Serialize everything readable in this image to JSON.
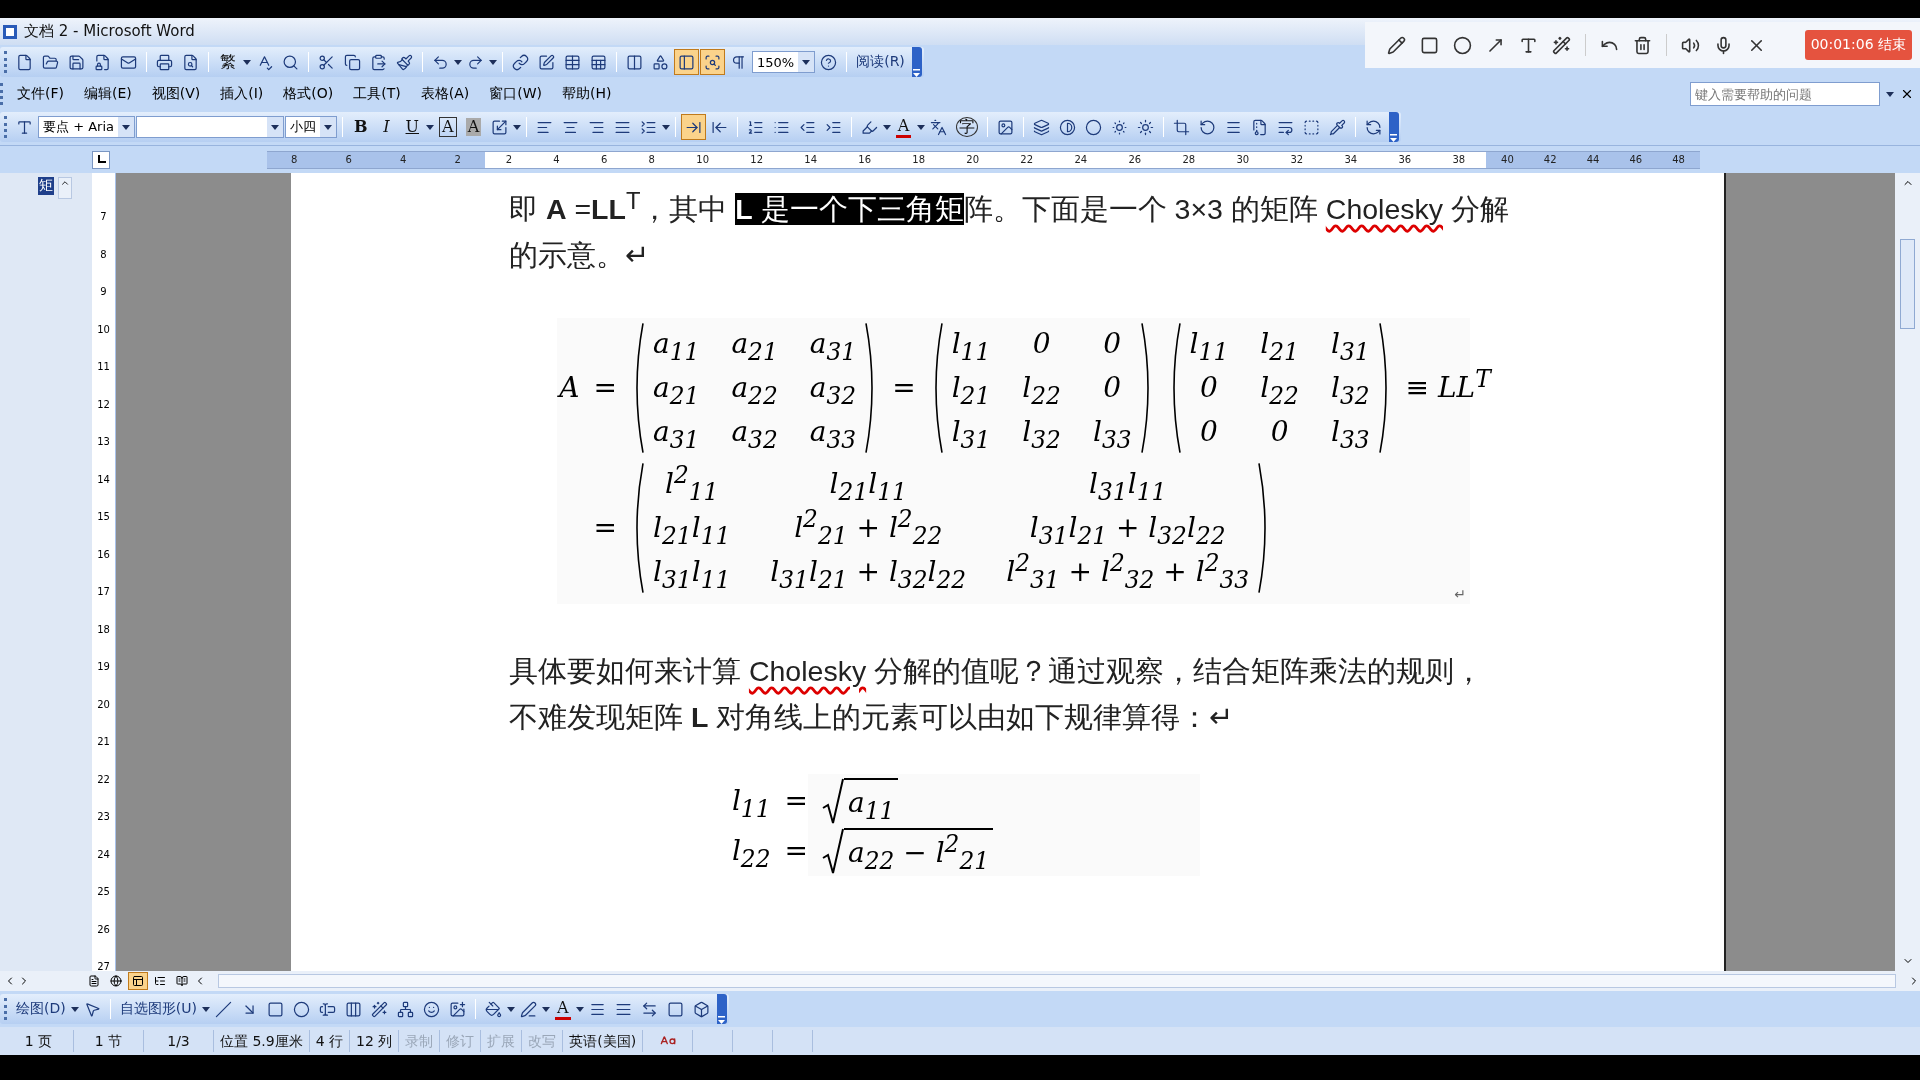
{
  "window": {
    "title": "文档 2 - Microsoft Word"
  },
  "standard_toolbar": [
    {
      "kind": "icon",
      "on": false
    },
    {
      "kind": "icon",
      "on": false
    },
    {
      "kind": "icon",
      "on": false
    },
    {
      "kind": "icon",
      "on": false
    },
    {
      "kind": "icon",
      "on": false
    },
    {
      "kind": "separator"
    },
    {
      "kind": "icon",
      "on": false
    },
    {
      "kind": "icon",
      "on": false
    },
    {
      "kind": "separator"
    },
    {
      "kind": "glyph",
      "text": "繁",
      "on": false
    },
    {
      "kind": "caret"
    },
    {
      "kind": "icon",
      "on": false
    },
    {
      "kind": "icon",
      "on": false
    },
    {
      "kind": "separator"
    },
    {
      "kind": "icon",
      "on": false
    },
    {
      "kind": "icon",
      "on": false
    },
    {
      "kind": "icon",
      "on": false
    },
    {
      "kind": "icon",
      "on": false
    },
    {
      "kind": "separator"
    },
    {
      "kind": "icon",
      "on": false
    },
    {
      "kind": "caret"
    },
    {
      "kind": "icon",
      "on": false
    },
    {
      "kind": "caret"
    },
    {
      "kind": "separator"
    },
    {
      "kind": "icon",
      "on": false
    },
    {
      "kind": "icon",
      "on": false
    },
    {
      "kind": "icon",
      "on": false
    },
    {
      "kind": "icon",
      "on": false
    },
    {
      "kind": "separator"
    },
    {
      "kind": "icon",
      "on": false
    },
    {
      "kind": "icon",
      "on": false
    },
    {
      "kind": "icon",
      "on": true
    },
    {
      "kind": "icon",
      "on": true
    },
    {
      "kind": "icon",
      "on": false
    },
    {
      "kind": "dropdown",
      "text": "150%"
    },
    {
      "kind": "icon",
      "on": false
    },
    {
      "kind": "separator"
    },
    {
      "kind": "text_button",
      "text": "阅读(R)"
    }
  ],
  "menu": [
    "文件(F)",
    "编辑(E)",
    "视图(V)",
    "插入(I)",
    "格式(O)",
    "工具(T)",
    "表格(A)",
    "窗口(W)",
    "帮助(H)"
  ],
  "help_search": {
    "placeholder": "键入需要帮助的问题"
  },
  "formatting_toolbar": [
    {
      "kind": "icon",
      "on": false
    },
    {
      "kind": "dropdown",
      "text": "要点 + Aria"
    },
    {
      "kind": "dropdown"
    },
    {
      "kind": "dropdown",
      "text": "小四"
    },
    {
      "kind": "separator"
    },
    {
      "kind": "glyph",
      "text": "B",
      "on": false
    },
    {
      "kind": "glyph",
      "text": "I",
      "on": false
    },
    {
      "kind": "glyph",
      "text": "U",
      "on": false
    },
    {
      "kind": "caret"
    },
    {
      "kind": "glyph",
      "text": "A",
      "on": false
    },
    {
      "kind": "glyph",
      "text": "A",
      "on": false
    },
    {
      "kind": "icon",
      "on": false
    },
    {
      "kind": "caret"
    },
    {
      "kind": "separator"
    },
    {
      "kind": "icon",
      "on": false
    },
    {
      "kind": "icon",
      "on": false
    },
    {
      "kind": "icon",
      "on": false
    },
    {
      "kind": "icon",
      "on": false
    },
    {
      "kind": "icon",
      "on": false
    },
    {
      "kind": "caret"
    },
    {
      "kind": "separator"
    },
    {
      "kind": "icon",
      "on": true
    },
    {
      "kind": "icon",
      "on": false
    },
    {
      "kind": "separator"
    },
    {
      "kind": "icon",
      "on": false
    },
    {
      "kind": "icon",
      "on": false
    },
    {
      "kind": "icon",
      "on": false
    },
    {
      "kind": "icon",
      "on": false
    },
    {
      "kind": "separator"
    },
    {
      "kind": "icon",
      "on": false
    },
    {
      "kind": "caret"
    },
    {
      "kind": "glyph",
      "text": "A",
      "on": false
    },
    {
      "kind": "caret"
    },
    {
      "kind": "icon",
      "on": false
    },
    {
      "kind": "glyph",
      "text": "字",
      "on": false
    },
    {
      "kind": "separator"
    },
    {
      "kind": "icon",
      "on": false
    },
    {
      "kind": "separator"
    },
    {
      "kind": "icon",
      "on": false
    },
    {
      "kind": "icon",
      "on": false
    },
    {
      "kind": "icon",
      "on": false
    },
    {
      "kind": "icon",
      "on": false
    },
    {
      "kind": "icon",
      "on": false
    },
    {
      "kind": "separator"
    },
    {
      "kind": "icon",
      "on": false
    },
    {
      "kind": "icon",
      "on": false
    },
    {
      "kind": "icon",
      "on": false
    },
    {
      "kind": "icon",
      "on": false
    },
    {
      "kind": "icon",
      "on": false
    },
    {
      "kind": "icon",
      "on": false
    },
    {
      "kind": "icon",
      "on": false
    },
    {
      "kind": "separator"
    },
    {
      "kind": "icon",
      "on": false
    }
  ],
  "recorder_toolbar": {
    "timer_button": "00:01:06 结束"
  },
  "ruler": {
    "left_numbers": [
      "8",
      "6",
      "4",
      "2"
    ],
    "numbers": [
      "2",
      "4",
      "6",
      "8",
      "10",
      "12",
      "14",
      "16",
      "18",
      "20",
      "22",
      "24",
      "26",
      "28",
      "30",
      "32",
      "34",
      "36",
      "38"
    ],
    "right_numbers": [
      "40",
      "42",
      "44",
      "46",
      "48"
    ]
  },
  "vertical_ruler": [
    "7",
    "8",
    "9",
    "10",
    "11",
    "12",
    "13",
    "14",
    "15",
    "16",
    "17",
    "18",
    "19",
    "20",
    "21",
    "22",
    "23",
    "24",
    "25",
    "26",
    "27"
  ],
  "navigation_pane": {
    "item": "矩"
  },
  "document": {
    "blocks": [
      {
        "kind": "paragraph",
        "segments": [
          {
            "text": "即 **A** =**LL**$^{T}$，其中 ",
            "selected": false,
            "misspelled": false
          },
          {
            "text": "**L** 是一个下三角矩",
            "selected": true,
            "misspelled": false
          },
          {
            "text": "阵。下面是一个 3×3 的矩阵 ",
            "selected": false,
            "misspelled": false
          },
          {
            "text": "Cholesky",
            "selected": false,
            "misspelled": true
          },
          {
            "text": " 分解的示意。↵",
            "selected": false,
            "misspelled": false
          }
        ]
      },
      {
        "kind": "equation",
        "rows": [
          {
            "items": [
              {
                "kind": "symbol",
                "text": "A"
              },
              {
                "kind": "symbol",
                "text": "="
              },
              {
                "kind": "matrix",
                "cells": [
                  [
                    "a$_{11}$",
                    "a$_{21}$",
                    "a$_{31}$"
                  ],
                  [
                    "a$_{21}$",
                    "a$_{22}$",
                    "a$_{32}$"
                  ],
                  [
                    "a$_{31}$",
                    "a$_{32}$",
                    "a$_{33}$"
                  ]
                ]
              },
              {
                "kind": "symbol",
                "text": "="
              },
              {
                "kind": "matrix",
                "cells": [
                  [
                    "l$_{11}$",
                    "0",
                    "0"
                  ],
                  [
                    "l$_{21}$",
                    "l$_{22}$",
                    "0"
                  ],
                  [
                    "l$_{31}$",
                    "l$_{32}$",
                    "l$_{33}$"
                  ]
                ]
              },
              {
                "kind": "matrix",
                "cells": [
                  [
                    "l$_{11}$",
                    "l$_{21}$",
                    "l$_{31}$"
                  ],
                  [
                    "0",
                    "l$_{22}$",
                    "l$_{32}$"
                  ],
                  [
                    "0",
                    "0",
                    "l$_{33}$"
                  ]
                ]
              },
              {
                "kind": "symbol",
                "text": "≡ LL$^{T}$"
              }
            ]
          },
          {
            "items": [
              {
                "kind": "symbol",
                "text": "="
              },
              {
                "kind": "matrix",
                "cells": [
                  [
                    "l$^{2}$$_{11}$",
                    "l$_{21}$l$_{11}$",
                    "l$_{31}$l$_{11}$"
                  ],
                  [
                    "l$_{21}$l$_{11}$",
                    "l$^{2}$$_{21}$ + l$^{2}$$_{22}$",
                    "l$_{31}$l$_{21}$ + l$_{32}$l$_{22}$"
                  ],
                  [
                    "l$_{31}$l$_{11}$",
                    "l$_{31}$l$_{21}$ + l$_{32}$l$_{22}$",
                    "l$^{2}$$_{31}$ + l$^{2}$$_{32}$ + l$^{2}$$_{33}$"
                  ]
                ]
              }
            ]
          }
        ],
        "mark": "↵"
      },
      {
        "kind": "paragraph",
        "segments": [
          {
            "text": "具体要如何来计算 ",
            "selected": false,
            "misspelled": false
          },
          {
            "text": "Cholesky",
            "selected": false,
            "misspelled": true
          },
          {
            "text": " 分解的值呢？通过观察，结合矩阵乘法的规则，不难发现矩阵 **L** 对角线上的元素可以由如下规律算得：↵",
            "selected": false,
            "misspelled": false
          }
        ]
      },
      {
        "kind": "equation",
        "rows": [
          {
            "items": [
              {
                "kind": "symbol",
                "text": "l$_{11}$"
              },
              {
                "kind": "symbol",
                "text": "="
              },
              {
                "kind": "sqrt",
                "text": "a$_{11}$"
              }
            ]
          },
          {
            "items": [
              {
                "kind": "symbol",
                "text": "l$_{22}$"
              },
              {
                "kind": "symbol",
                "text": "="
              },
              {
                "kind": "sqrt",
                "text": "a$_{22}$ − l$^{2}$$_{21}$"
              }
            ]
          }
        ]
      }
    ]
  },
  "view_buttons": [
    {
      "selected": false
    },
    {
      "selected": false
    },
    {
      "selected": true
    },
    {
      "selected": false
    },
    {
      "selected": false
    }
  ],
  "drawing_toolbar": [
    {
      "kind": "text_button",
      "text": "绘图(D)"
    },
    {
      "kind": "caret"
    },
    {
      "kind": "icon",
      "on": false
    },
    {
      "kind": "separator"
    },
    {
      "kind": "text_button",
      "text": "自选图形(U)"
    },
    {
      "kind": "caret"
    },
    {
      "kind": "icon",
      "on": false
    },
    {
      "kind": "icon",
      "on": false
    },
    {
      "kind": "icon",
      "on": false
    },
    {
      "kind": "icon",
      "on": false
    },
    {
      "kind": "icon",
      "on": false
    },
    {
      "kind": "icon",
      "on": false
    },
    {
      "kind": "icon",
      "on": false
    },
    {
      "kind": "icon",
      "on": false
    },
    {
      "kind": "icon",
      "on": false
    },
    {
      "kind": "icon",
      "on": false
    },
    {
      "kind": "separator"
    },
    {
      "kind": "icon",
      "on": false
    },
    {
      "kind": "caret"
    },
    {
      "kind": "icon",
      "on": false
    },
    {
      "kind": "caret"
    },
    {
      "kind": "glyph",
      "text": "A",
      "on": false
    },
    {
      "kind": "caret"
    },
    {
      "kind": "icon",
      "on": false
    },
    {
      "kind": "icon",
      "on": false
    },
    {
      "kind": "icon",
      "on": false
    },
    {
      "kind": "icon",
      "on": false
    },
    {
      "kind": "icon",
      "on": false
    }
  ],
  "status_bar": [
    {
      "text": "1 页",
      "disabled": false
    },
    {
      "text": "1 节",
      "disabled": false
    },
    {
      "text": "1/3",
      "disabled": false
    },
    {
      "text": "位置 5.9厘米",
      "disabled": false
    },
    {
      "text": "4 行",
      "disabled": false
    },
    {
      "text": "12 列",
      "disabled": false
    },
    {
      "text": "录制",
      "disabled": true
    },
    {
      "text": "修订",
      "disabled": true
    },
    {
      "text": "扩展",
      "disabled": true
    },
    {
      "text": "改写",
      "disabled": true
    },
    {
      "text": "英语(美国)",
      "disabled": false
    }
  ]
}
